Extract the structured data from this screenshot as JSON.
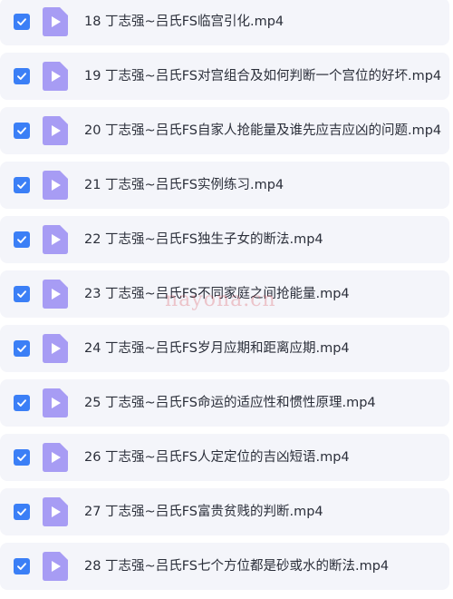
{
  "colors": {
    "checkbox": "#3b7ff6",
    "file_icon": "#a79cf4",
    "row_background": "#f4f5fa",
    "text": "#2b2f3a",
    "watermark": "#d64650"
  },
  "icons": {
    "checkbox": "checkmark-icon",
    "file": "video-file-icon"
  },
  "files": [
    {
      "name": "18 丁志强~吕氏FS临宫引化.mp4",
      "checked": true
    },
    {
      "name": "19 丁志强~吕氏FS对宫组合及如何判断一个宫位的好坏.mp4",
      "checked": true
    },
    {
      "name": "20 丁志强~吕氏FS自家人抢能量及谁先应吉应凶的问题.mp4",
      "checked": true
    },
    {
      "name": "21 丁志强~吕氏FS实例练习.mp4",
      "checked": true
    },
    {
      "name": "22 丁志强~吕氏FS独生子女的断法.mp4",
      "checked": true
    },
    {
      "name": "23 丁志强~吕氏FS不同家庭之间抢能量.mp4",
      "checked": true
    },
    {
      "name": "24 丁志强~吕氏FS岁月应期和距离应期.mp4",
      "checked": true
    },
    {
      "name": "25 丁志强~吕氏FS命运的适应性和惯性原理.mp4",
      "checked": true
    },
    {
      "name": "26 丁志强~吕氏FS人定定位的吉凶短语.mp4",
      "checked": true
    },
    {
      "name": "27 丁志强~吕氏FS富贵贫贱的判断.mp4",
      "checked": true
    },
    {
      "name": "28 丁志强~吕氏FS七个方位都是砂或水的断法.mp4",
      "checked": true
    }
  ],
  "watermark": "nayona.cn"
}
